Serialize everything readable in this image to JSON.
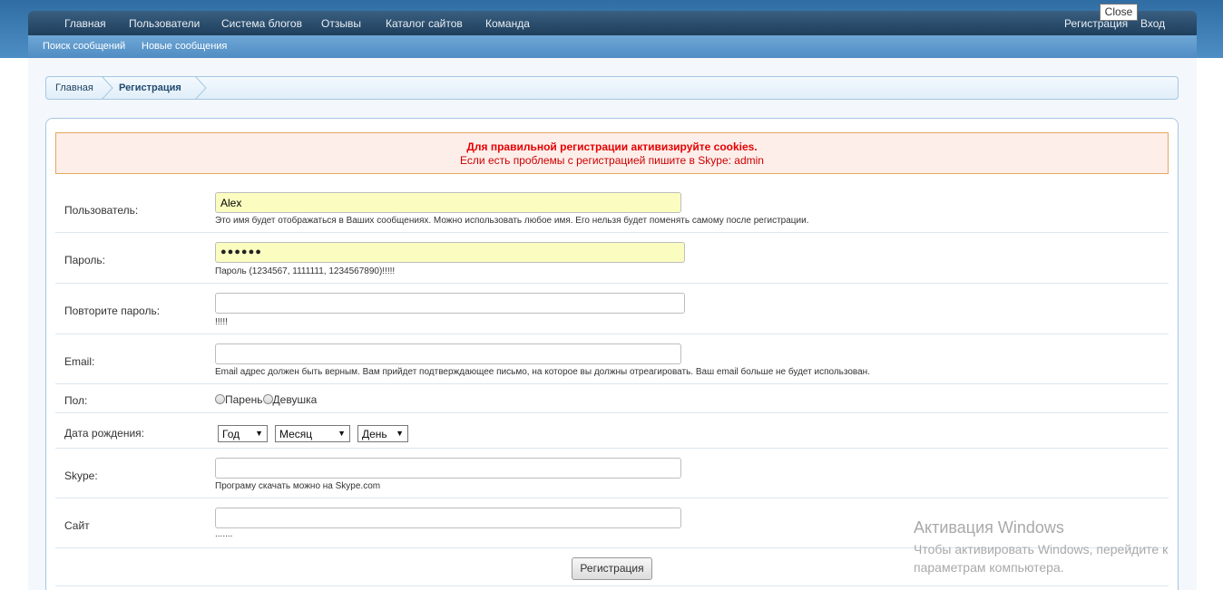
{
  "nav": {
    "main_items": [
      "Главная",
      "Пользователи",
      "Система блогов",
      "Отзывы",
      "Каталог сайтов",
      "Команда"
    ],
    "register": "Регистрация",
    "login": "Вход",
    "sub_items": [
      "Поиск сообщений",
      "Новые сообщения"
    ]
  },
  "tooltip": {
    "close": "Close"
  },
  "breadcrumb": {
    "home": "Главная",
    "current": "Регистрация"
  },
  "notice": {
    "line1": "Для правильной регистрации активизируйте cookies.",
    "line2": "Если есть проблемы с регистрацией пишите в Skype: admin"
  },
  "form": {
    "username": {
      "label": "Пользователь:",
      "value": "Alex",
      "hint": "Это имя будет отображаться в Ваших сообщениях. Можно использовать любое имя. Его нельзя будет поменять самому после регистрации."
    },
    "password": {
      "label": "Пароль:",
      "value": "●●●●●●",
      "hint": "Пароль (1234567, 1111111, 1234567890)!!!!!"
    },
    "password_confirm": {
      "label": "Повторите пароль:",
      "value": "",
      "hint": "!!!!!"
    },
    "email": {
      "label": "Email:",
      "value": "",
      "hint": "Email адрес должен быть верным. Вам прийдет подтверждающее письмо, на которое вы должны отреагировать. Ваш email больше не будет использован."
    },
    "gender": {
      "label": "Пол:",
      "male": "Парень",
      "female": "Девушка"
    },
    "birthday": {
      "label": "Дата рождения:",
      "year": "Год",
      "month": "Месяц",
      "day": "День"
    },
    "skype": {
      "label": "Skype:",
      "value": "",
      "hint": "Програму скачать можно на Skype.com"
    },
    "site": {
      "label": "Сайт",
      "value": "",
      "hint": "......."
    },
    "submit": "Регистрация"
  },
  "watermark": {
    "title": "Активация Windows",
    "line1": "Чтобы активировать Windows, перейдите к",
    "line2": "параметрам компьютера."
  },
  "colors": {
    "nav_dark": "#1f3e5c",
    "nav_light": "#4f8cc3",
    "notice_red": "#e60000",
    "field_filled": "#fbfdc0"
  }
}
